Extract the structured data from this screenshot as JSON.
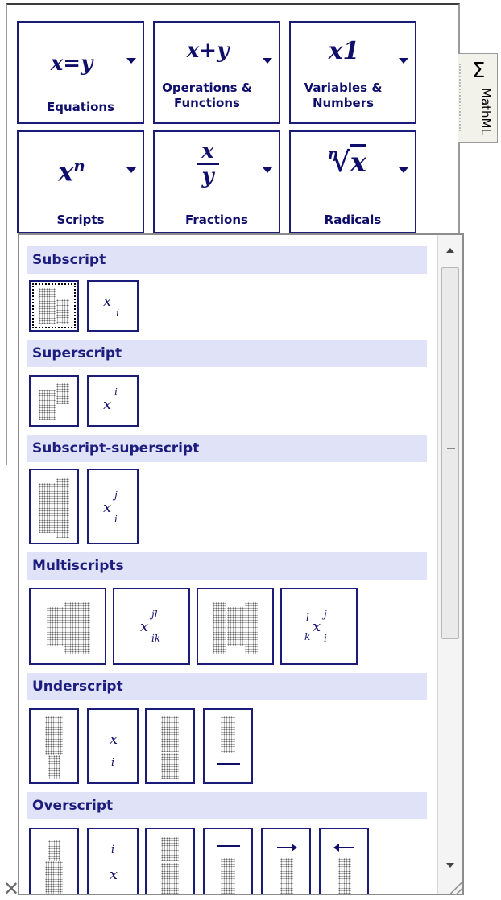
{
  "categories": [
    {
      "glyph": "x=y",
      "label": "Equations"
    },
    {
      "glyph": "x+y",
      "label": "Operations & Functions"
    },
    {
      "glyph": "x1",
      "label": "Variables & Numbers"
    },
    {
      "glyph_base": "x",
      "glyph_sup": "n",
      "label": "Scripts"
    },
    {
      "glyph_num": "x",
      "glyph_den": "y",
      "label": "Fractions"
    },
    {
      "glyph_index": "n",
      "glyph_radicand": "x",
      "label": "Radicals"
    }
  ],
  "side_tab": {
    "icon": "sigma-icon",
    "symbol": "Σ",
    "label": "MathML"
  },
  "sections": [
    {
      "title": "Subscript"
    },
    {
      "title": "Superscript"
    },
    {
      "title": "Subscript-superscript"
    },
    {
      "title": "Multiscripts"
    },
    {
      "title": "Underscript"
    },
    {
      "title": "Overscript"
    }
  ],
  "glyphs": {
    "x": "x",
    "i": "i",
    "j": "j",
    "k": "k",
    "l": "l",
    "jl": "jl",
    "ik": "ik"
  },
  "footer": {
    "close_symbol": "✕"
  },
  "colors": {
    "accent": "#1b1b7a",
    "header_bg": "#e0e2f8",
    "header_text": "#1d1d7e"
  }
}
